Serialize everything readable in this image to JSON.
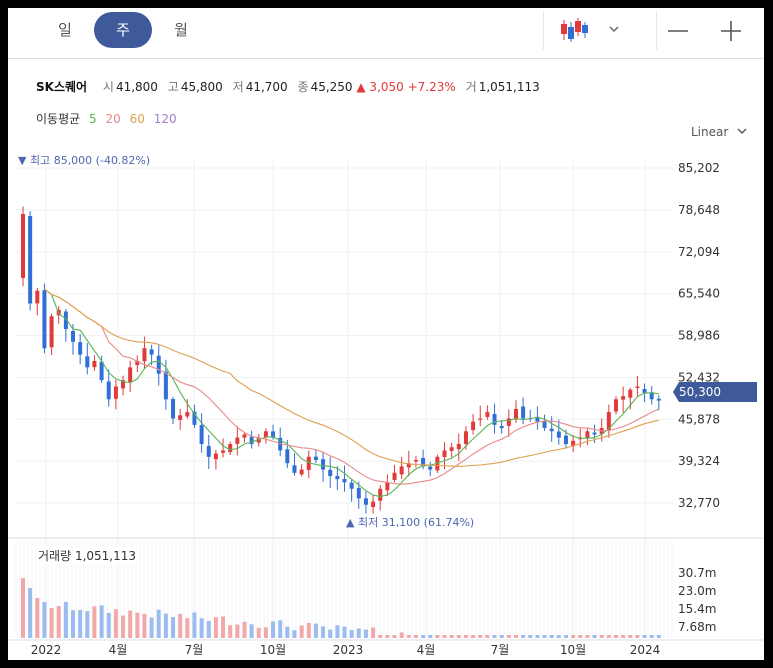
{
  "tabs": [
    {
      "label": "일"
    },
    {
      "label": "주"
    },
    {
      "label": "월"
    }
  ],
  "active_tab": 1,
  "toolbar": {
    "chart_type_icon": "candlestick-icon",
    "zoom_out": "—",
    "zoom_in": "+"
  },
  "stock": {
    "name": "SK스퀘어",
    "open_label": "시",
    "open": "41,800",
    "high_label": "고",
    "high": "45,800",
    "low_label": "저",
    "low": "41,700",
    "close_label": "종",
    "close": "45,250",
    "change": "▲ 3,050",
    "change_pct": "+7.23%",
    "volume_label": "거",
    "volume": "1,051,113"
  },
  "moving_average": {
    "label": "이동평균",
    "periods": [
      "5",
      "20",
      "60",
      "120"
    ],
    "colors": [
      "#5ab552",
      "#e98a8a",
      "#e0a050",
      "#a07bd0"
    ]
  },
  "scale": {
    "label": "Linear"
  },
  "annotations": {
    "high": "▼ 최고 85,000 (-40.82%)",
    "low": "▲ 최저 31,100 (61.74%)"
  },
  "current_price_tag": "50,300",
  "volume_panel": {
    "label": "거래량",
    "value": "1,051,113"
  },
  "colors": {
    "up": "#e03a3a",
    "down": "#2f6fd6",
    "up_volume": "#f3a8a8",
    "down_volume": "#9bbcf0",
    "accent": "#3f5a9a"
  },
  "chart_data": {
    "type": "candlestick",
    "y_ticks": [
      "85,202",
      "78,648",
      "72,094",
      "65,540",
      "58,986",
      "52,432",
      "45,878",
      "39,324",
      "32,770"
    ],
    "ylim": [
      32770,
      85202
    ],
    "x_ticks": [
      "2022",
      "4월",
      "7월",
      "10월",
      "2023",
      "4월",
      "7월",
      "10월",
      "2024"
    ],
    "volume_ticks": [
      "30.7m",
      "23.0m",
      "15.4m",
      "7.68m"
    ],
    "closing_prices_weekly": [
      78000,
      64000,
      66000,
      57000,
      62000,
      63000,
      60000,
      58000,
      56000,
      54000,
      55000,
      52000,
      49000,
      51000,
      52000,
      54000,
      55000,
      57000,
      56000,
      53000,
      49000,
      46000,
      46500,
      47000,
      45000,
      42000,
      40000,
      40500,
      41000,
      42000,
      43000,
      43500,
      42000,
      43000,
      44000,
      43000,
      41000,
      39000,
      37500,
      38000,
      40000,
      39500,
      38000,
      37000,
      36500,
      36000,
      35000,
      33500,
      32500,
      33000,
      35000,
      36000,
      37500,
      38500,
      39000,
      39500,
      38500,
      38000,
      40000,
      41000,
      41500,
      42000,
      44000,
      45500,
      46000,
      47000,
      45000,
      44500,
      46000,
      47500,
      46000,
      46000,
      45500,
      44500,
      44000,
      43000,
      42000,
      42500,
      43000,
      44000,
      43500,
      44500,
      47000,
      49000,
      49500,
      50500,
      51000,
      50000,
      49000,
      48800
    ]
  }
}
